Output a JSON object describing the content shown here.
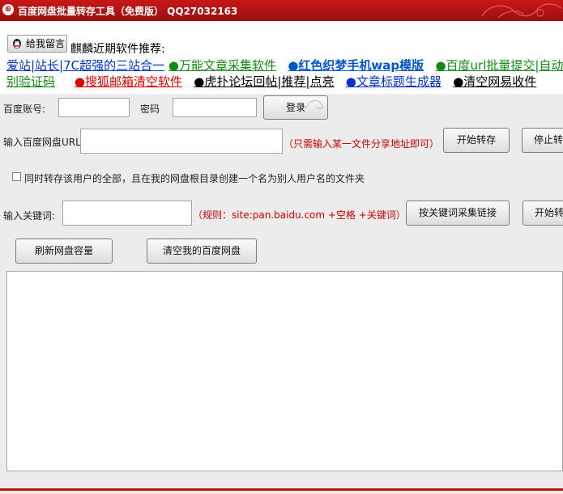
{
  "window": {
    "title": "百度网盘批量转存工具（免费版） QQ27032163"
  },
  "banner": {
    "message_button": "给我留言",
    "heading": "麒麟近期软件推荐:",
    "row1": [
      {
        "text": "爱站|站长|7C超强的三站合一",
        "color": "blue"
      },
      {
        "text": "●万能文章采集软件",
        "color": "green"
      },
      {
        "text": "●红色织梦手机wap模版",
        "color": "bold-blue"
      },
      {
        "text": "●百度url批量提交|自动",
        "color": "green"
      }
    ],
    "row2": [
      {
        "text": "别验证码",
        "color": "green"
      },
      {
        "text": "●搜狐邮箱清空软件",
        "color": "red"
      },
      {
        "text": "●虎扑论坛回帖|推荐|点亮",
        "color": "black"
      },
      {
        "text": "●文章标题生成器",
        "color": "blue"
      },
      {
        "text": "●清空网易收件",
        "color": "black"
      }
    ]
  },
  "login": {
    "account_label": "百度账号:",
    "account_value": "",
    "password_label": "密码",
    "password_value": "",
    "login_button": "登录"
  },
  "url_section": {
    "label": "输入百度网盘URL",
    "value": "",
    "hint": "（只需输入某一文件分享地址即可）",
    "start_button": "开始转存",
    "stop_button": "停止转"
  },
  "option": {
    "checked": false,
    "label": "同时转存该用户的全部，且在我的网盘根目录创建一个名为别人用户名的文件夹"
  },
  "keyword_section": {
    "label": "输入关键词:",
    "value": "",
    "hint": "（规则：site:pan.baidu.com +空格 +关键词）",
    "collect_button": "按关键词采集链接",
    "start_button": "开始转"
  },
  "actions": {
    "refresh_button": "刷新网盘容量",
    "clear_button": "清空我的百度网盘"
  },
  "log": {
    "text": ""
  },
  "colors": {
    "titlebar": "#b81414",
    "hint": "#cc0000",
    "link_blue": "#0033cc",
    "link_green": "#138a13"
  }
}
